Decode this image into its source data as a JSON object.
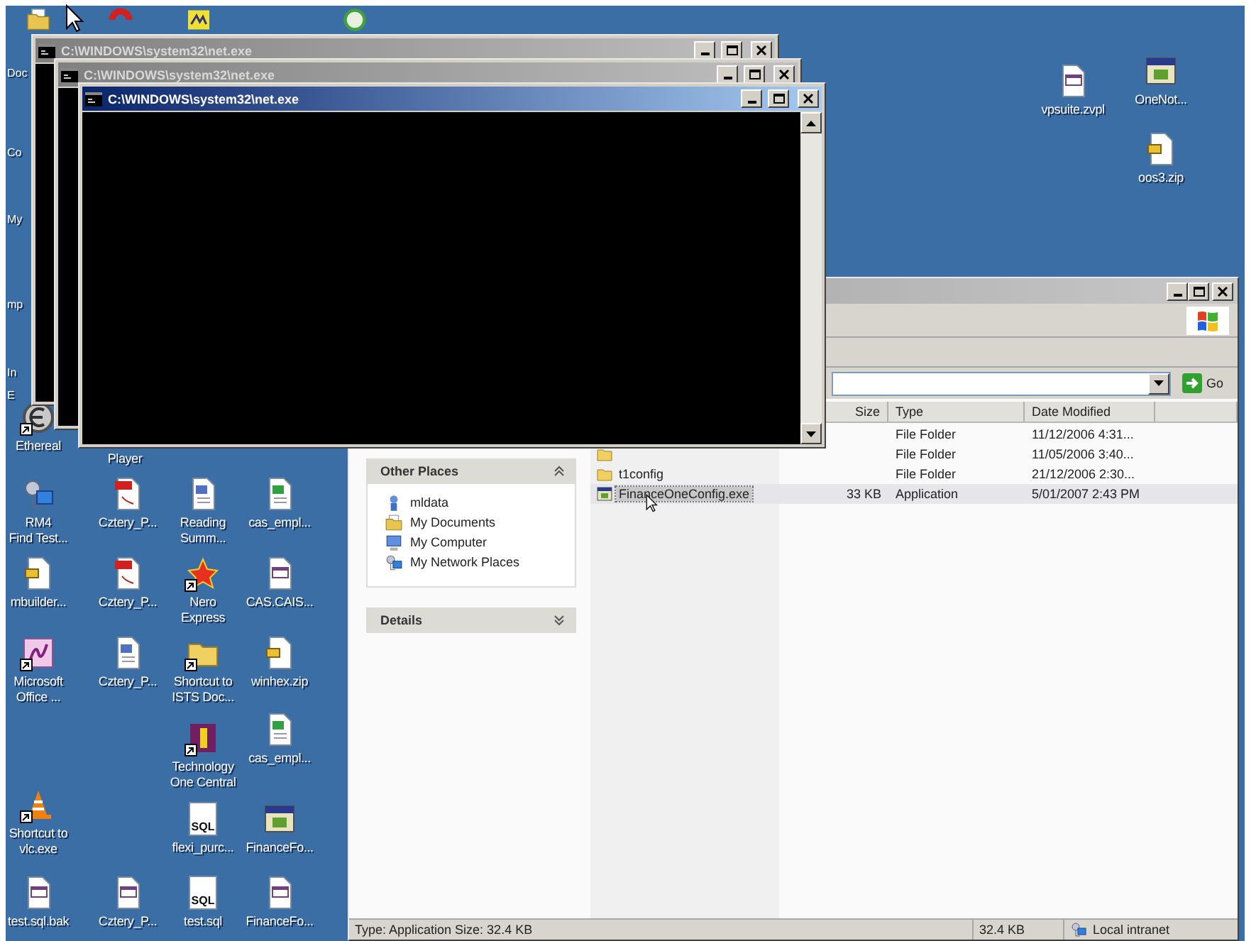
{
  "desktop": {
    "edge_labels": [
      "Doc",
      "Co",
      "My",
      "mp",
      "In",
      "E"
    ],
    "icons": [
      {
        "kind": "documents",
        "shortcut": false
      },
      {
        "kind": "arc",
        "shortcut": false
      },
      {
        "kind": "tile",
        "shortcut": false
      },
      {
        "kind": "disc",
        "shortcut": false
      },
      {
        "kind": "app",
        "shortcut": false,
        "lines": [
          "OneNot..."
        ]
      },
      {
        "kind": "text",
        "shortcut": false,
        "lines": [
          "vpsuite.zvpl"
        ]
      },
      {
        "kind": "zip",
        "shortcut": false,
        "lines": [
          "oos3.zip"
        ]
      },
      {
        "kind": "ethereal",
        "shortcut": true,
        "lines": [
          "Ethereal"
        ]
      },
      {
        "kind": "label",
        "lines": [
          "Player"
        ]
      },
      {
        "kind": "network",
        "shortcut": false,
        "lines": [
          "RM4",
          "Find Test..."
        ]
      },
      {
        "kind": "pdf",
        "shortcut": false,
        "lines": [
          "Cztery_P..."
        ]
      },
      {
        "kind": "word",
        "shortcut": false,
        "lines": [
          "Reading",
          "Summ..."
        ]
      },
      {
        "kind": "excel",
        "shortcut": false,
        "lines": [
          "cas_empl..."
        ]
      },
      {
        "kind": "zip",
        "shortcut": false,
        "lines": [
          "mbuilder..."
        ]
      },
      {
        "kind": "pdf",
        "shortcut": false,
        "lines": [
          "Cztery_P..."
        ]
      },
      {
        "kind": "nero",
        "shortcut": true,
        "lines": [
          "Nero",
          "Express"
        ]
      },
      {
        "kind": "text",
        "shortcut": false,
        "lines": [
          "CAS.CAIS..."
        ]
      },
      {
        "kind": "office",
        "shortcut": true,
        "lines": [
          "Microsoft",
          "Office ..."
        ]
      },
      {
        "kind": "word",
        "shortcut": false,
        "lines": [
          "Cztery_P..."
        ]
      },
      {
        "kind": "folder",
        "shortcut": true,
        "lines": [
          "Shortcut to",
          "ISTS Doc..."
        ]
      },
      {
        "kind": "zip",
        "shortcut": false,
        "lines": [
          "winhex.zip"
        ]
      },
      {
        "kind": "excel",
        "shortcut": false,
        "lines": [
          "cas_empl..."
        ]
      },
      {
        "kind": "tech",
        "shortcut": true,
        "lines": [
          "Technology",
          "One Central"
        ]
      },
      {
        "kind": "cone",
        "shortcut": true,
        "lines": [
          "Shortcut to",
          "vlc.exe"
        ]
      },
      {
        "kind": "sql",
        "badge": "SQL",
        "shortcut": false,
        "lines": [
          "flexi_purc..."
        ]
      },
      {
        "kind": "app",
        "shortcut": false,
        "lines": [
          "FinanceFo..."
        ]
      },
      {
        "kind": "text",
        "shortcut": false,
        "lines": [
          "test.sql.bak"
        ]
      },
      {
        "kind": "text",
        "shortcut": false,
        "lines": [
          "Cztery_P..."
        ]
      },
      {
        "kind": "sql",
        "badge": "SQL",
        "shortcut": false,
        "lines": [
          "test.sql"
        ]
      },
      {
        "kind": "text",
        "shortcut": false,
        "lines": [
          "FinanceFo..."
        ]
      }
    ]
  },
  "consoles": [
    {
      "title": "C:\\WINDOWS\\system32\\net.exe",
      "active": false
    },
    {
      "title": "C:\\WINDOWS\\system32\\net.exe",
      "active": false
    },
    {
      "title": "C:\\WINDOWS\\system32\\net.exe",
      "active": true
    }
  ],
  "explorer": {
    "active": false,
    "go_label": "Go",
    "columns": [
      "Size",
      "Type",
      "Date Modified"
    ],
    "rows": [
      {
        "kind": "folder",
        "type": "File Folder",
        "date": "11/12/2006 4:31...",
        "selected": false
      },
      {
        "kind": "folder",
        "type": "File Folder",
        "date": "11/05/2006 3:40...",
        "selected": false
      },
      {
        "kind": "folder",
        "name": "t1config",
        "type": "File Folder",
        "date": "21/12/2006 2:30...",
        "selected": false
      },
      {
        "kind": "app",
        "name": "FinanceOneConfig.exe",
        "size": "33 KB",
        "type": "Application",
        "date": "5/01/2007 2:43 PM",
        "selected": true
      }
    ],
    "panes": [
      {
        "title": "Other Places",
        "expanded": true,
        "items": [
          {
            "label": "mldata",
            "kind": "drive"
          },
          {
            "label": "My Documents",
            "kind": "documents"
          },
          {
            "label": "My Computer",
            "kind": "computer"
          },
          {
            "label": "My Network Places",
            "kind": "network"
          }
        ]
      },
      {
        "title": "Details",
        "expanded": false
      }
    ],
    "status": {
      "info": "Type: Application Size: 32.4 KB",
      "size": "32.4 KB",
      "zone": "Local intranet"
    }
  }
}
